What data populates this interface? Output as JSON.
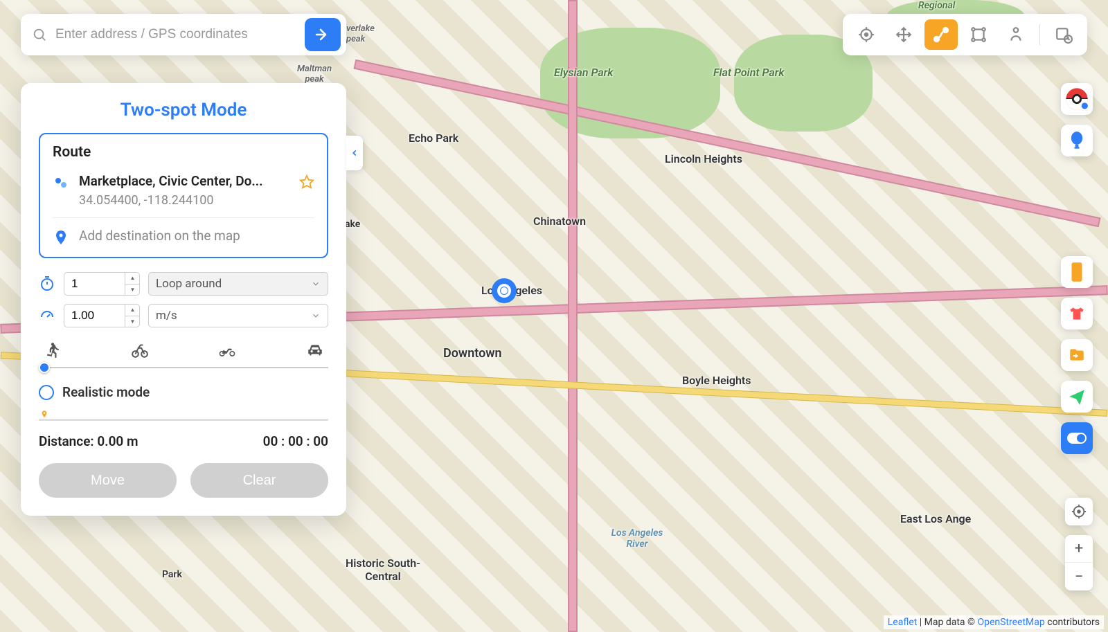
{
  "search": {
    "placeholder": "Enter address / GPS coordinates"
  },
  "panel": {
    "title": "Two-spot Mode",
    "route_heading": "Route",
    "destination": {
      "name": "Marketplace, Civic Center, Do...",
      "coords": "34.054400, -118.244100"
    },
    "add_destination_hint": "Add destination on the map",
    "loop_count": "1",
    "loop_mode": "Loop around",
    "speed_value": "1.00",
    "speed_unit": "m/s",
    "realistic_label": "Realistic mode",
    "distance_label": "Distance: 0.00 m",
    "time_label": "00 : 00 : 00",
    "move_btn": "Move",
    "clear_btn": "Clear"
  },
  "map_labels": {
    "los_angeles": "Los Angeles",
    "downtown": "Downtown",
    "chinatown": "Chinatown",
    "echo_park": "Echo Park",
    "elysian_park": "Elysian Park",
    "lincoln_heights": "Lincoln Heights",
    "boyle_heights": "Boyle Heights",
    "flat_point_park": "Flat Point Park",
    "east_la": "East Los Ange",
    "historic_south": "Historic South-Central",
    "la_river": "Los Angeles River",
    "maltman_peak": "Maltman peak",
    "verlake_peak": "verlake peak",
    "lake": "ake",
    "regional": "Regional",
    "park": "Park"
  },
  "attribution": {
    "leaflet": "Leaflet",
    "mid": " | Map data © ",
    "osm": "OpenStreetMap",
    "tail": " contributors"
  }
}
